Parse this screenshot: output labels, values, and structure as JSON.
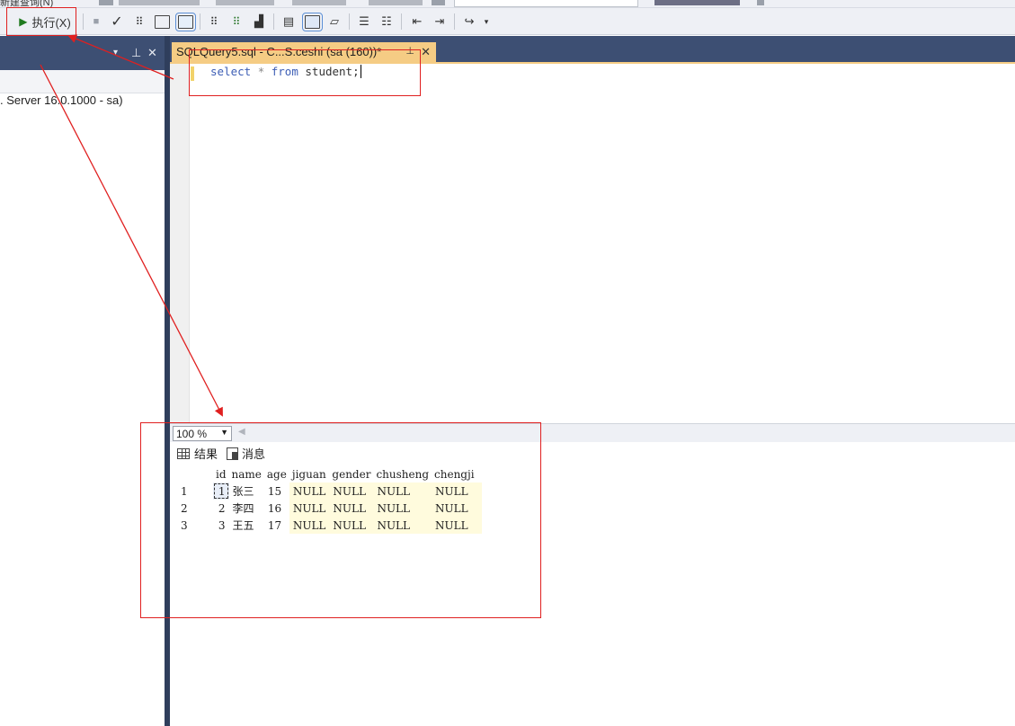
{
  "toolbar_top": {
    "partial_label": "新建查询(N)"
  },
  "toolbar": {
    "execute_label": "执行(X)",
    "execute_icon": "play-icon",
    "stop_icon": "stop-icon",
    "parse_icon": "checkmark-icon"
  },
  "object_explorer": {
    "server_node": ". Server 16.0.1000 - sa)",
    "controls": [
      "▾",
      "⊥",
      "✕"
    ]
  },
  "editor_tab": {
    "title": "SQLQuery5.sql - C...S.ceshi (sa (160))*",
    "pin": "⊥",
    "close": "✕"
  },
  "editor": {
    "keyword_select": "select",
    "operator_star": "*",
    "keyword_from": "from",
    "table_name": "student;"
  },
  "results": {
    "zoom": "100 %",
    "tab_results": "结果",
    "tab_messages": "消息",
    "columns": [
      "id",
      "name",
      "age",
      "jiguan",
      "gender",
      "chusheng",
      "chengji"
    ],
    "rows": [
      {
        "rownum": "1",
        "id": "1",
        "name": "张三",
        "age": "15",
        "jiguan": "NULL",
        "gender": "NULL",
        "chusheng": "NULL",
        "chengji": "NULL"
      },
      {
        "rownum": "2",
        "id": "2",
        "name": "李四",
        "age": "16",
        "jiguan": "NULL",
        "gender": "NULL",
        "chusheng": "NULL",
        "chengji": "NULL"
      },
      {
        "rownum": "3",
        "id": "3",
        "name": "王五",
        "age": "17",
        "jiguan": "NULL",
        "gender": "NULL",
        "chusheng": "NULL",
        "chengji": "NULL"
      }
    ]
  },
  "colors": {
    "annotation": "#e02020",
    "tab_active": "#f5cc84",
    "header_dark": "#3d4f73",
    "null_cell": "#fffbdd"
  }
}
